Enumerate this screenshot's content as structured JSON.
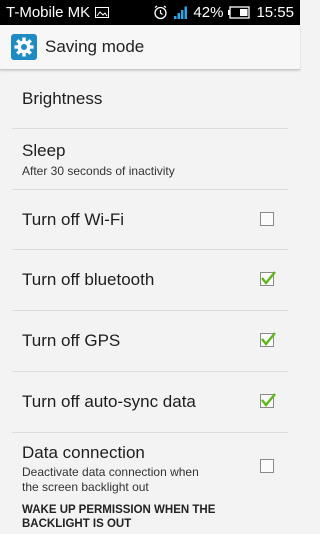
{
  "status_bar": {
    "carrier": "T-Mobile MK",
    "battery_percent": "42%",
    "time": "15:55",
    "icons": [
      "image-icon",
      "alarm-icon",
      "signal-icon",
      "battery-icon"
    ]
  },
  "action_bar": {
    "title": "Saving mode",
    "icon": "settings-gear-icon",
    "accent": "#1e8bc3"
  },
  "settings": {
    "brightness": {
      "title": "Brightness"
    },
    "sleep": {
      "title": "Sleep",
      "subtitle": "After 30 seconds of inactivity"
    },
    "wifi": {
      "title": "Turn off Wi-Fi",
      "checked": false
    },
    "bluetooth": {
      "title": "Turn off bluetooth",
      "checked": true
    },
    "gps": {
      "title": "Turn off GPS",
      "checked": true
    },
    "autosync": {
      "title": "Turn off auto-sync data",
      "checked": true
    },
    "data_connection": {
      "title": "Data connection",
      "subtitle_line1": "Deactivate data connection when",
      "subtitle_line2": "the screen backlight out",
      "checked": false
    }
  },
  "section_header": {
    "line1": "WAKE UP PERMISSION WHEN THE",
    "line2": "BACKLIGHT IS OUT"
  },
  "colors": {
    "check_green": "#5cb814"
  }
}
